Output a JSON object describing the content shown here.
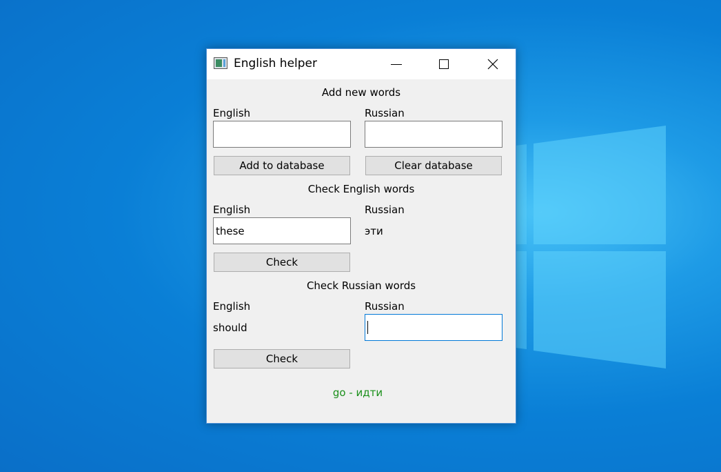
{
  "window": {
    "title": "English helper"
  },
  "add_section": {
    "heading": "Add new words",
    "english_label": "English",
    "russian_label": "Russian",
    "english_value": "",
    "russian_value": "",
    "add_button": "Add to database",
    "clear_button": "Clear database"
  },
  "check_english": {
    "heading": "Check English words",
    "english_label": "English",
    "russian_label": "Russian",
    "english_value": "these",
    "russian_value": "эти",
    "check_button": "Check"
  },
  "check_russian": {
    "heading": "Check Russian words",
    "english_label": "English",
    "russian_label": "Russian",
    "english_value": "should",
    "russian_value": "",
    "check_button": "Check"
  },
  "result": {
    "text": "go - идти",
    "color": "#1a8f1a"
  },
  "icons": {
    "app": "app-icon",
    "minimize": "minimize-icon",
    "maximize": "maximize-icon",
    "close": "close-icon"
  }
}
